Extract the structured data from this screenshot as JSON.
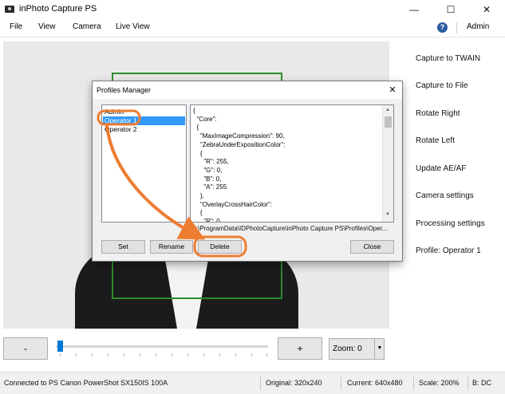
{
  "window": {
    "title": "inPhoto Capture PS",
    "minimize_glyph": "—",
    "maximize_glyph": "☐",
    "close_glyph": "✕"
  },
  "menu": {
    "items": [
      "File",
      "View",
      "Camera",
      "Live View"
    ],
    "help_glyph": "?",
    "user": "Admin"
  },
  "side_panel": {
    "items": [
      "Capture to TWAIN",
      "Capture to File",
      "Rotate Right",
      "Rotate Left",
      "Update AE/AF",
      "Camera settings",
      "Processing settings",
      "Profile: Operator 1"
    ]
  },
  "controls": {
    "minus_label": "-",
    "plus_label": "+",
    "zoom_label": "Zoom: 0",
    "zoom_arrow": "▼",
    "zoom_slider_value": 0
  },
  "status_bar": {
    "connection": "Connected to PS Canon PowerShot SX150IS 100A",
    "original": "Original: 320x240",
    "current": "Current: 640x480",
    "scale": "Scale: 200%",
    "b": "B: DC"
  },
  "dialog": {
    "title": "Profiles Manager",
    "close_glyph": "✕",
    "profiles": [
      "Admin",
      "Operator 1",
      "Operator 2"
    ],
    "selected_profile": "Operator 1",
    "json_lines": [
      "{",
      "  \"Core\":",
      "  {",
      "    \"MaxImageCompression\": 90,",
      "    \"ZebraUnderExpositionColor\":",
      "    {",
      "      \"R\": 255,",
      "      \"G\": 0,",
      "      \"B\": 0,",
      "      \"A\": 255",
      "    },",
      "    \"OverlayCrossHairColor\":",
      "    {",
      "      \"R\": 0,"
    ],
    "scroll_up_glyph": "▲",
    "scroll_down_glyph": "▼",
    "path": "C:\\ProgramData\\IDPhotoCapture\\inPhoto Capture PS\\Profiles\\Oper...",
    "buttons": {
      "set": "Set",
      "rename": "Rename",
      "delete": "Delete",
      "close": "Close"
    }
  },
  "colors": {
    "selection": "#3399ff",
    "annotation": "#ed7d31",
    "crop_frame": "#2e8b2e",
    "help_icon": "#2d5aa0"
  }
}
